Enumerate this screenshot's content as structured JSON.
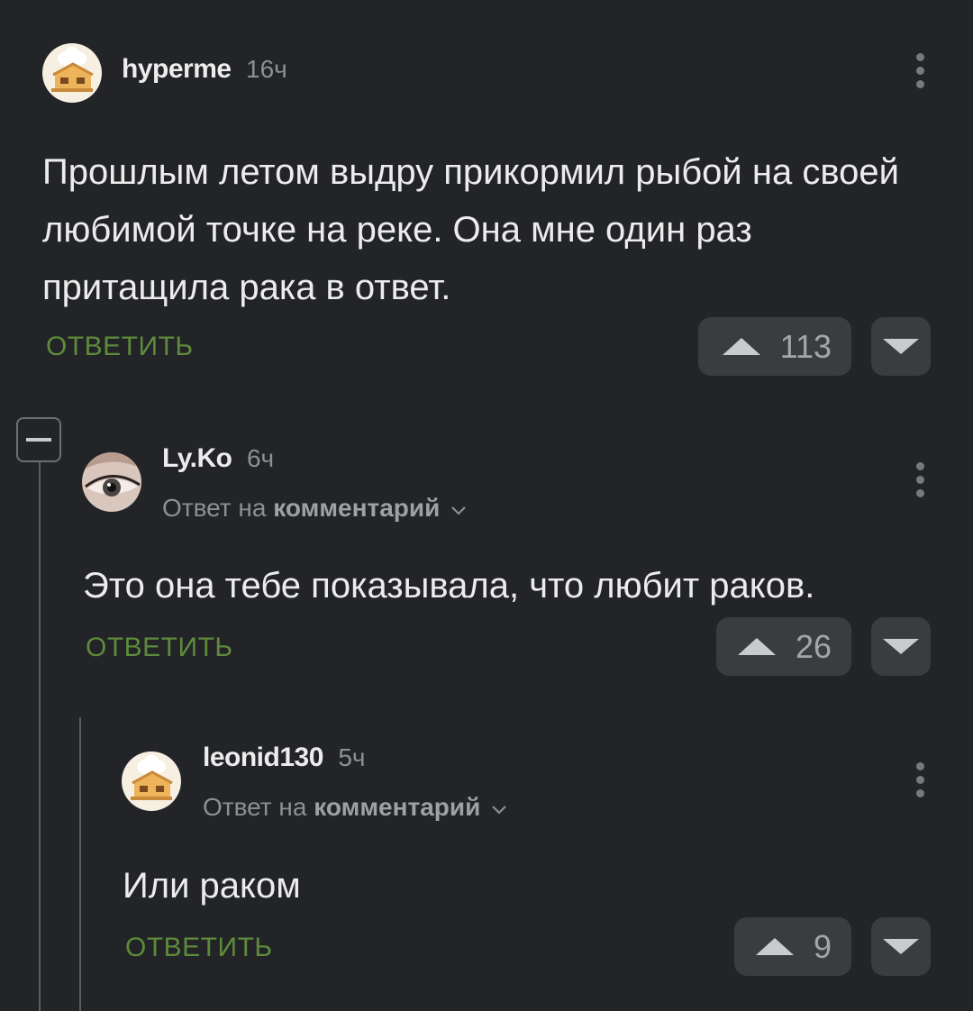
{
  "comments": [
    {
      "username": "hyperme",
      "time": "16ч",
      "text": "Прошлым летом выдру прикормил рыбой на своей любимой точке на реке. Она мне один раз притащила рака в ответ.",
      "reply_label": "ОТВЕТИТЬ",
      "votes": "113",
      "avatar_icon": "chef-house-icon"
    },
    {
      "username": "Ly.Ko",
      "time": "6ч",
      "reply_prefix": "Ответ на",
      "reply_target": "комментарий",
      "text": "Это она тебе показывала, что любит раков.",
      "reply_label": "ОТВЕТИТЬ",
      "votes": "26",
      "avatar_icon": "eye-photo-avatar"
    },
    {
      "username": "leonid130",
      "time": "5ч",
      "reply_prefix": "Ответ на",
      "reply_target": "комментарий",
      "text": "Или раком",
      "reply_label": "ОТВЕТИТЬ",
      "votes": "9",
      "avatar_icon": "chef-house-icon"
    }
  ],
  "colors": {
    "background": "#222427",
    "reply_accent": "#5e8a3c",
    "text": "#ececec",
    "muted": "#8d8f92"
  }
}
